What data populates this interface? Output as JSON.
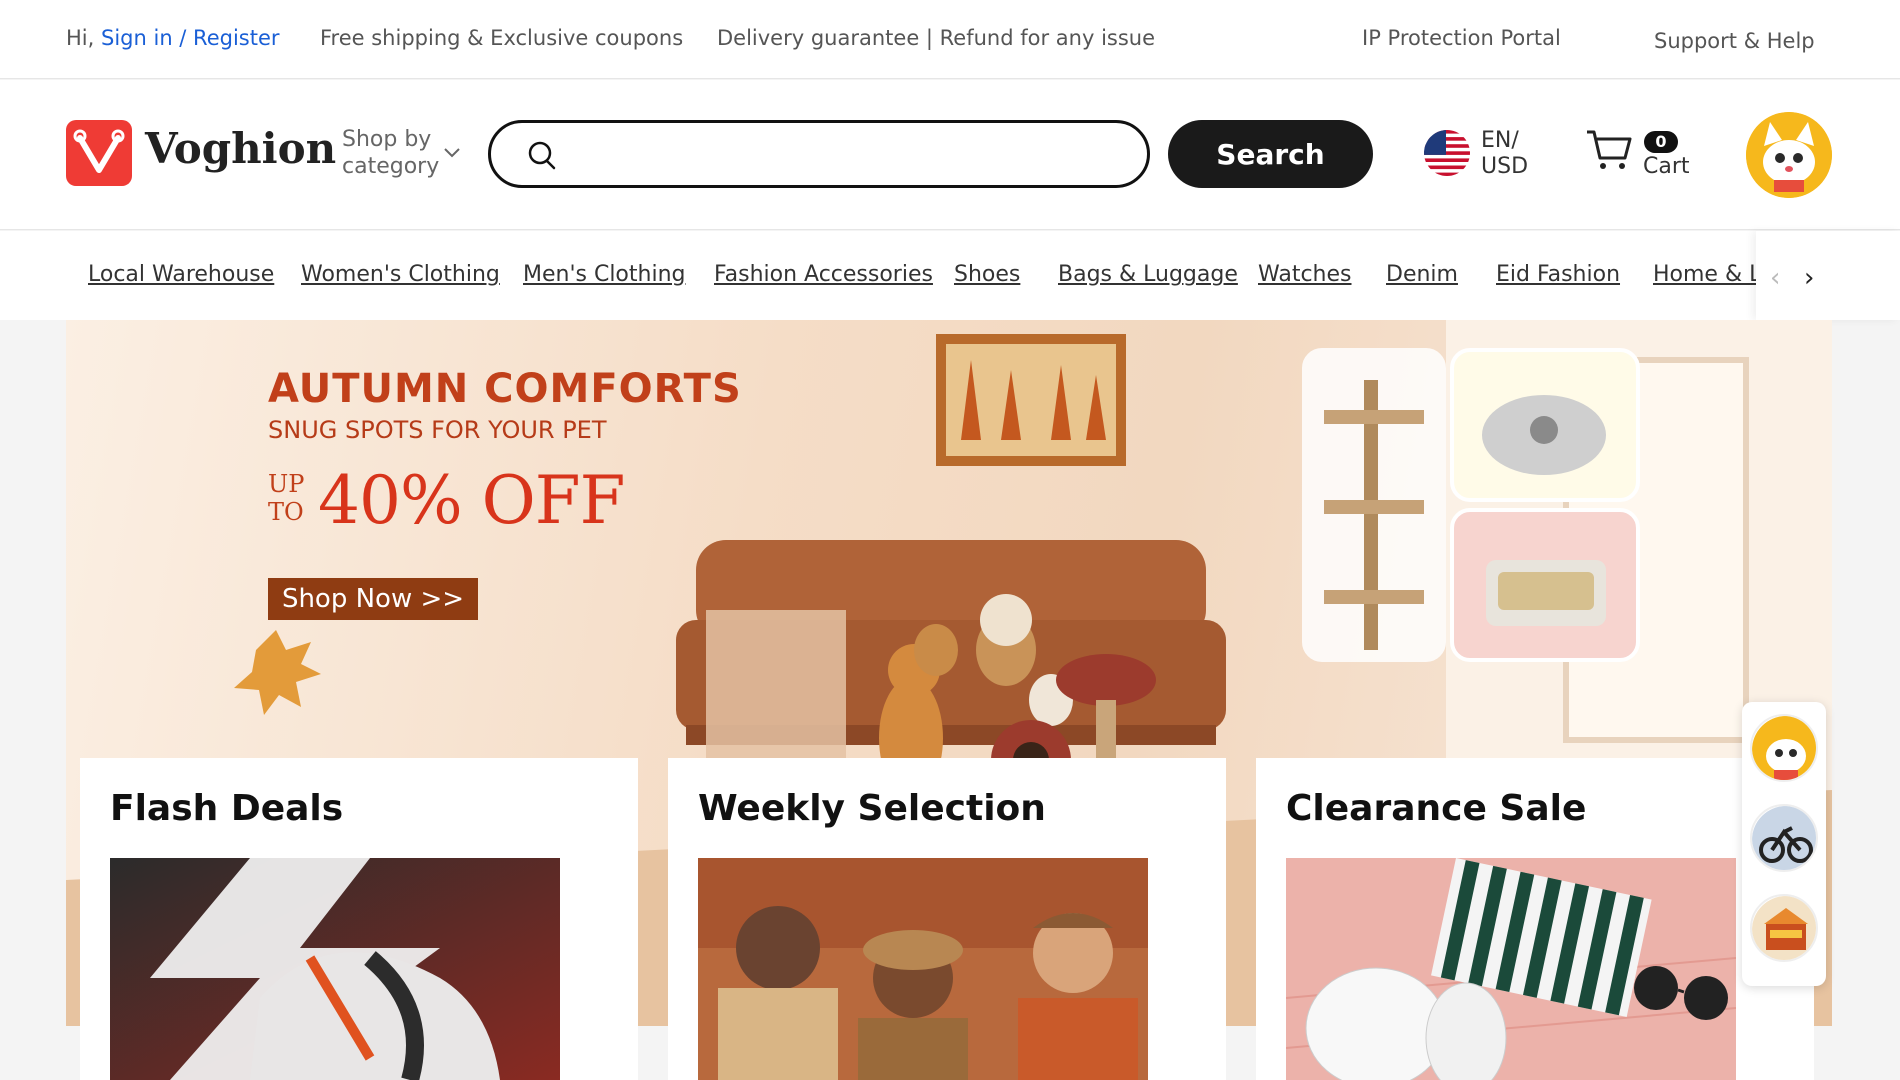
{
  "topbar": {
    "greeting": "Hi,",
    "signin": "Sign in / Register",
    "shipping": "Free shipping & Exclusive coupons",
    "delivery": "Delivery guarantee | Refund for any issue",
    "ip_portal": "IP Protection Portal",
    "support": "Support & Help"
  },
  "header": {
    "brand": "Voghion",
    "shop_by_category": "Shop by category",
    "search_placeholder": "",
    "search_button": "Search",
    "lang_line1": "EN/",
    "lang_line2": "USD",
    "cart_count": "0",
    "cart_label": "Cart"
  },
  "categories": [
    "Local Warehouse",
    "Women's Clothing",
    "Men's Clothing",
    "Fashion Accessories",
    "Shoes",
    "Bags & Luggage",
    "Watches",
    "Denim",
    "Eid Fashion",
    "Home & Li"
  ],
  "banner": {
    "title": "AUTUMN COMFORTS",
    "subtitle": "SNUG SPOTS FOR YOUR PET",
    "upto": "UP TO",
    "discount": "40% OFF",
    "cta": "Shop Now >>"
  },
  "cards": [
    {
      "title": "Flash Deals"
    },
    {
      "title": "Weekly Selection"
    },
    {
      "title": "Clearance Sale"
    }
  ],
  "colors": {
    "brand_red": "#ef3b35",
    "link_blue": "#1a5fd6",
    "banner_orange": "#c1401a",
    "search_button": "#1a1a1a"
  },
  "icons": {
    "search": "search-icon",
    "chevron": "chevron-down-icon",
    "cart": "cart-icon",
    "flag": "us-flag-icon"
  }
}
